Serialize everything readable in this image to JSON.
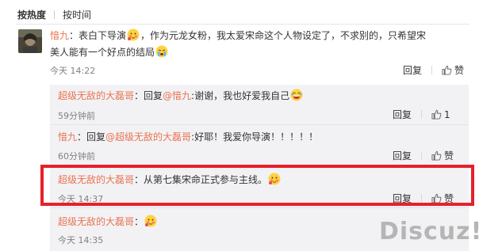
{
  "sort_tabs": [
    {
      "label": "按热度",
      "active": true
    },
    {
      "label": "按时间",
      "active": false
    }
  ],
  "main_comment": {
    "user": "愔九",
    "text_before": "：表白下导演",
    "text_after": "，作为元龙女粉，我太爱宋命这个人物设定了，不求别的，只希望宋美人能有一个好点的结局",
    "time": "今天 14:22",
    "reply_label": "回复",
    "like_label": "赞"
  },
  "replies": [
    {
      "user": "超级无敌的大磊哥",
      "pre": "：回复",
      "at": "@愔九",
      "text": ":谢谢，我也好爱我自己",
      "emoji": "laugh-emoji",
      "time": "59分钟前",
      "reply_label": "回复",
      "like_label": "1"
    },
    {
      "user": "愔九",
      "pre": "：回复",
      "at": "@超级无敌的大磊哥",
      "text": ":好耶！我爱你导演！！！！！",
      "emoji": "",
      "time": "60分钟前",
      "reply_label": "回复",
      "like_label": "赞"
    },
    {
      "user": "超级无敌的大磊哥",
      "pre": "",
      "at": "",
      "text": "：从第七集宋命正式参与主线。",
      "emoji": "shy-emoji",
      "time": "今天 14:37",
      "reply_label": "回复",
      "like_label": "赞"
    },
    {
      "user": "超级无敌的大磊哥",
      "pre": "",
      "at": "",
      "text": "：",
      "emoji": "shy-emoji",
      "time": "今天 14:35",
      "reply_label": "",
      "like_label": ""
    }
  ],
  "watermark": "Discuz!",
  "colors": {
    "username": "#eb7350",
    "highlight_border": "#e8202a",
    "reply_bg": "#f2f2f5"
  }
}
